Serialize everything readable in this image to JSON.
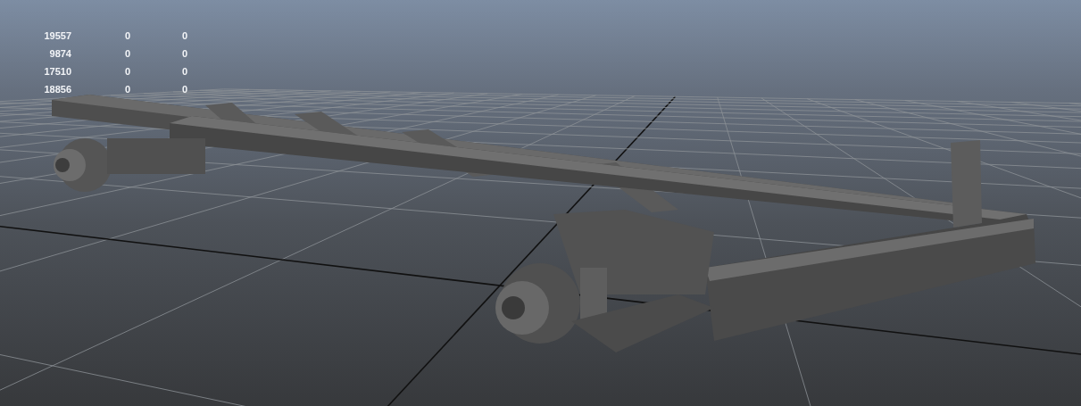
{
  "hud_stats": {
    "rows": [
      {
        "cells": [
          "19557",
          "0",
          "0"
        ]
      },
      {
        "cells": [
          "9874",
          "0",
          "0"
        ]
      },
      {
        "cells": [
          "17510",
          "0",
          "0"
        ]
      },
      {
        "cells": [
          "18856",
          "0",
          "0"
        ]
      }
    ]
  }
}
